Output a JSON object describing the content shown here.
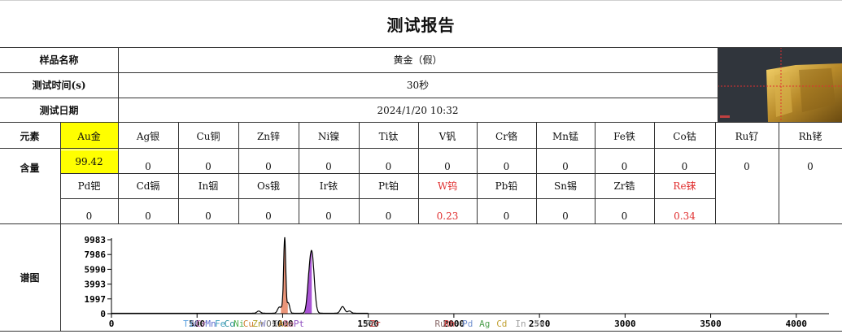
{
  "title": "测试报告",
  "info": {
    "sample_name_label": "样品名称",
    "sample_name_value": "黄金（假）",
    "test_time_label": "测试时间(s)",
    "test_time_value": "30秒",
    "test_date_label": "测试日期",
    "test_date_value": "2024/1/20 10:32"
  },
  "row1": {
    "element_label": "元素",
    "content_label": "含量",
    "elements": [
      "Au金",
      "Ag银",
      "Cu铜",
      "Zn锌",
      "Ni镍",
      "Ti钛",
      "V钒",
      "Cr铬",
      "Mn锰",
      "Fe铁",
      "Co钴",
      "Ru钌",
      "Rh铑"
    ],
    "values": [
      "99.42",
      "0",
      "0",
      "0",
      "0",
      "0",
      "0",
      "0",
      "0",
      "0",
      "0",
      "0",
      "0"
    ]
  },
  "row2": {
    "elements": [
      "Pd钯",
      "Cd镉",
      "In铟",
      "Os锇",
      "Ir铱",
      "Pt铂",
      "W钨",
      "Pb铅",
      "Sn锡",
      "Zr锆",
      "Re铼"
    ],
    "values": [
      "0",
      "0",
      "0",
      "0",
      "0",
      "0",
      "0.23",
      "0",
      "0",
      "0",
      "0.34"
    ]
  },
  "colors": {
    "highlight": "#ffff00",
    "alert_red": "#e03030"
  },
  "spectrum": {
    "label": "谱图",
    "chart_data": {
      "type": "line",
      "xlim": [
        0,
        4096
      ],
      "ylim": [
        0,
        9983
      ],
      "xticks": [
        0,
        500,
        1000,
        1500,
        2000,
        2500,
        3000,
        3500,
        4000
      ],
      "yticks": [
        0,
        1997,
        3993,
        5990,
        7986,
        9983
      ],
      "peaks": [
        {
          "x": 860,
          "height": 300,
          "width": 10
        },
        {
          "x": 980,
          "height": 800,
          "width": 10
        },
        {
          "x": 1000,
          "height": 700,
          "width": 8
        },
        {
          "x": 1012,
          "height": 9983,
          "width": 6
        },
        {
          "x": 1033,
          "height": 1400,
          "width": 8
        },
        {
          "x": 1150,
          "height": 1800,
          "width": 10
        },
        {
          "x": 1170,
          "height": 8200,
          "width": 14
        },
        {
          "x": 1350,
          "height": 900,
          "width": 12
        },
        {
          "x": 1390,
          "height": 300,
          "width": 10
        }
      ],
      "fills": [
        {
          "color": "#e98a6a",
          "x0": 990,
          "x1": 1030
        },
        {
          "color": "#a040d0",
          "x0": 1130,
          "x1": 1170
        }
      ],
      "markers": [
        {
          "text": "Ti",
          "x": 450,
          "color": "#5aa0e0"
        },
        {
          "text": "V",
          "x": 485,
          "color": "#8888cc"
        },
        {
          "text": "Cr",
          "x": 525,
          "color": "#c070c0"
        },
        {
          "text": "Mn",
          "x": 580,
          "color": "#6070d0"
        },
        {
          "text": "Fe",
          "x": 635,
          "color": "#40a0c0"
        },
        {
          "text": "Co",
          "x": 690,
          "color": "#3090a0"
        },
        {
          "text": "Ni",
          "x": 745,
          "color": "#50b050"
        },
        {
          "text": "Cu",
          "x": 800,
          "color": "#d08030"
        },
        {
          "text": "Zn",
          "x": 855,
          "color": "#b0a020"
        },
        {
          "text": "W",
          "x": 885,
          "color": "#8080c0"
        },
        {
          "text": "Os",
          "x": 935,
          "color": "#707070"
        },
        {
          "text": "Ir",
          "x": 975,
          "color": "#909090"
        },
        {
          "text": "Au",
          "x": 1005,
          "color": "#c08020"
        },
        {
          "text": "Re",
          "x": 1035,
          "color": "#d080a0"
        },
        {
          "text": "Pt",
          "x": 1095,
          "color": "#9050c0"
        },
        {
          "text": "Pb",
          "x": 1515,
          "color": "#707070"
        },
        {
          "text": "Zr",
          "x": 1540,
          "color": "#d04040"
        },
        {
          "text": "Ru",
          "x": 1920,
          "color": "#8a6a6a"
        },
        {
          "text": "Rh",
          "x": 1975,
          "color": "#d04040"
        },
        {
          "text": "Pd",
          "x": 2080,
          "color": "#7090d0"
        },
        {
          "text": "Ag",
          "x": 2180,
          "color": "#50a050"
        },
        {
          "text": "Cd",
          "x": 2280,
          "color": "#c0a030"
        },
        {
          "text": "In",
          "x": 2390,
          "color": "#a0a0a0"
        },
        {
          "text": "Sn",
          "x": 2500,
          "color": "#b0b0b0"
        }
      ]
    }
  }
}
